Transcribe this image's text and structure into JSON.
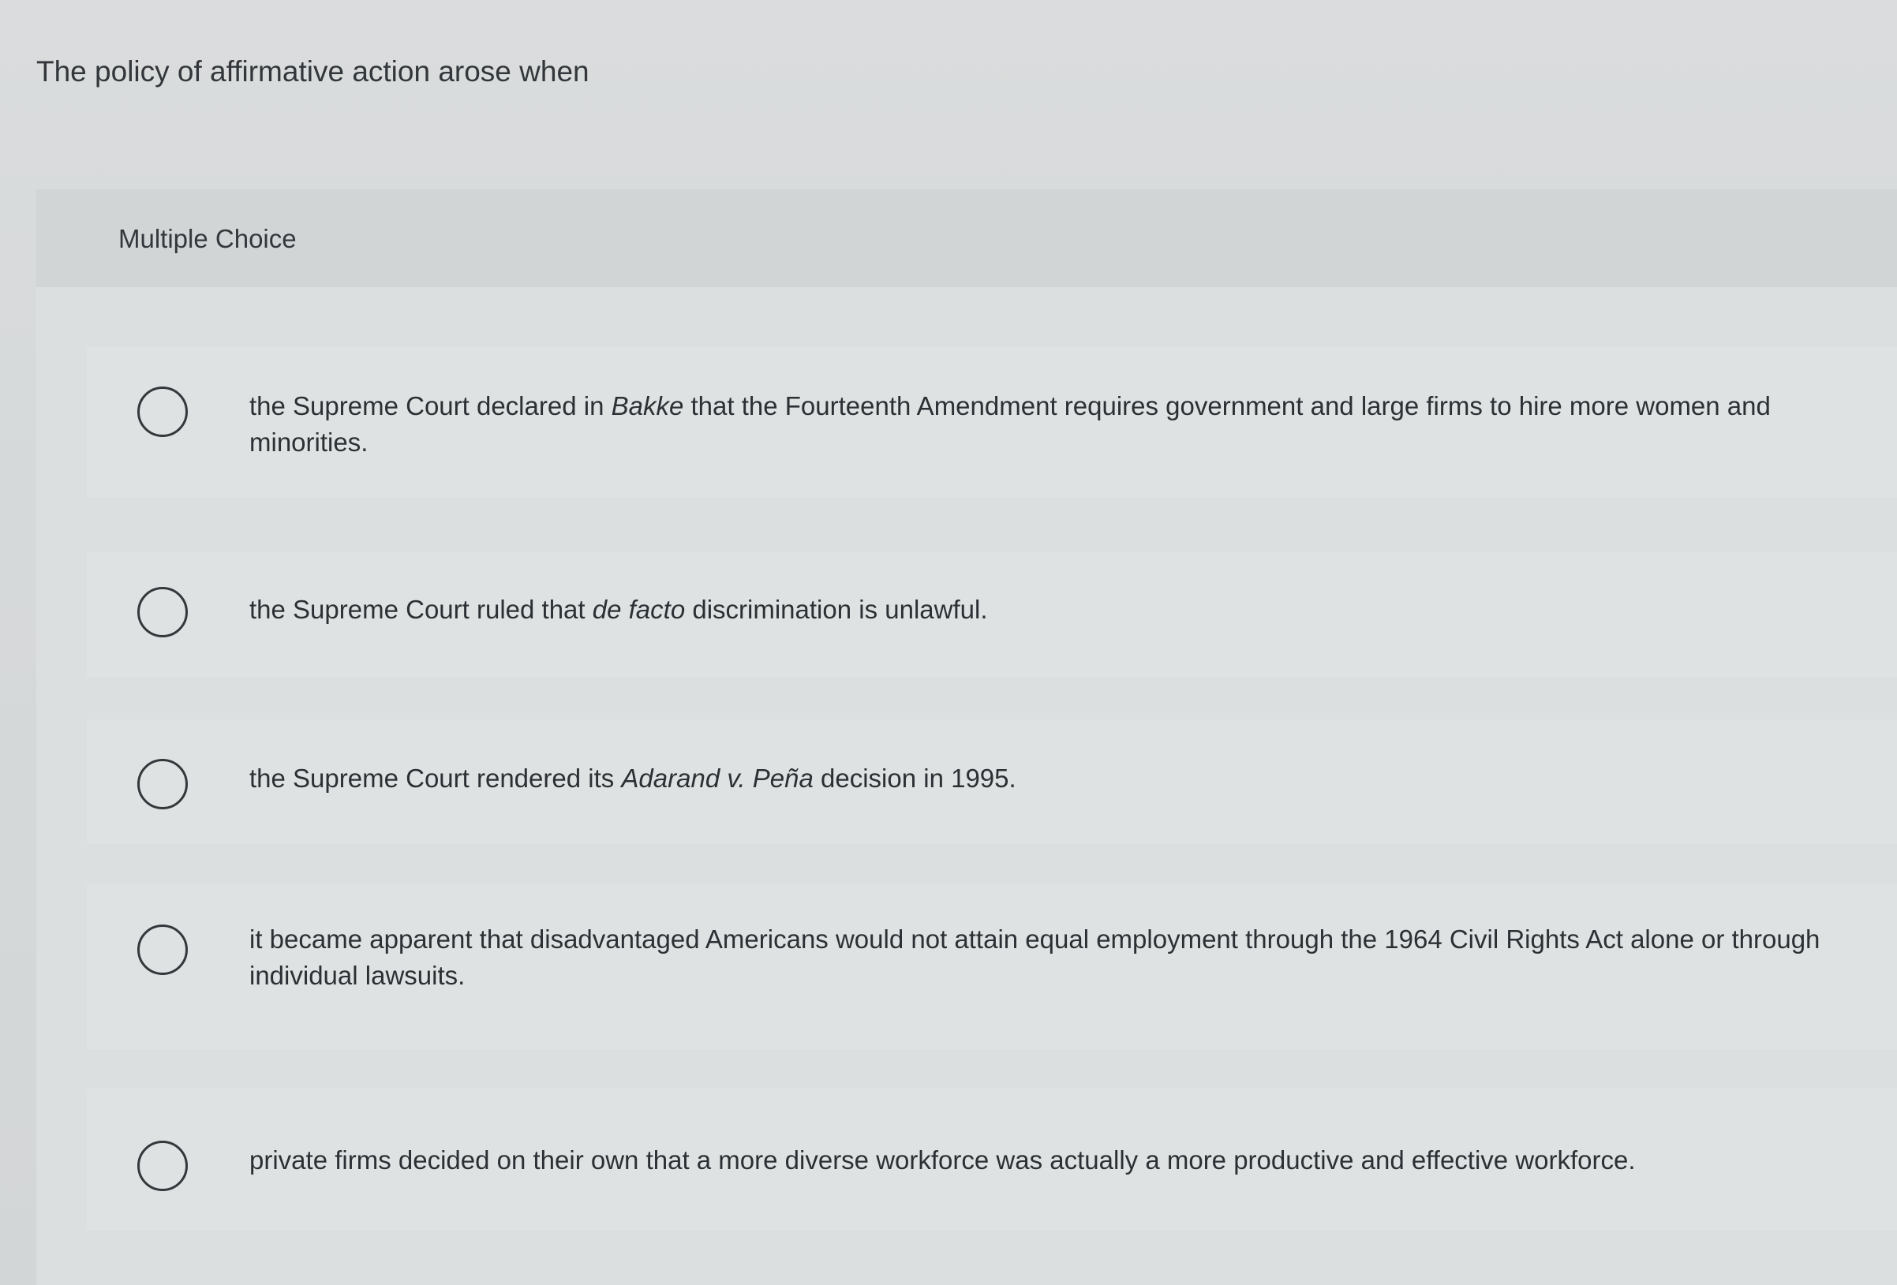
{
  "question": {
    "text": "The policy of affirmative action arose when"
  },
  "panel": {
    "header_label": "Multiple Choice"
  },
  "options": [
    {
      "pre": "the Supreme Court declared in ",
      "italic": "Bakke",
      "post": " that the Fourteenth Amendment requires government and large firms to hire more women and minorities."
    },
    {
      "pre": "the Supreme Court ruled that ",
      "italic": "de facto",
      "post": " discrimination is unlawful."
    },
    {
      "pre": "the Supreme Court rendered its ",
      "italic": "Adarand v. Peña",
      "post": " decision in 1995."
    },
    {
      "pre": "it became apparent that disadvantaged Americans would not attain equal employment through the 1964 Civil Rights Act alone or through individual lawsuits.",
      "italic": "",
      "post": ""
    },
    {
      "pre": "private firms decided on their own that a more diverse workforce was actually a more productive and effective workforce.",
      "italic": "",
      "post": ""
    }
  ]
}
